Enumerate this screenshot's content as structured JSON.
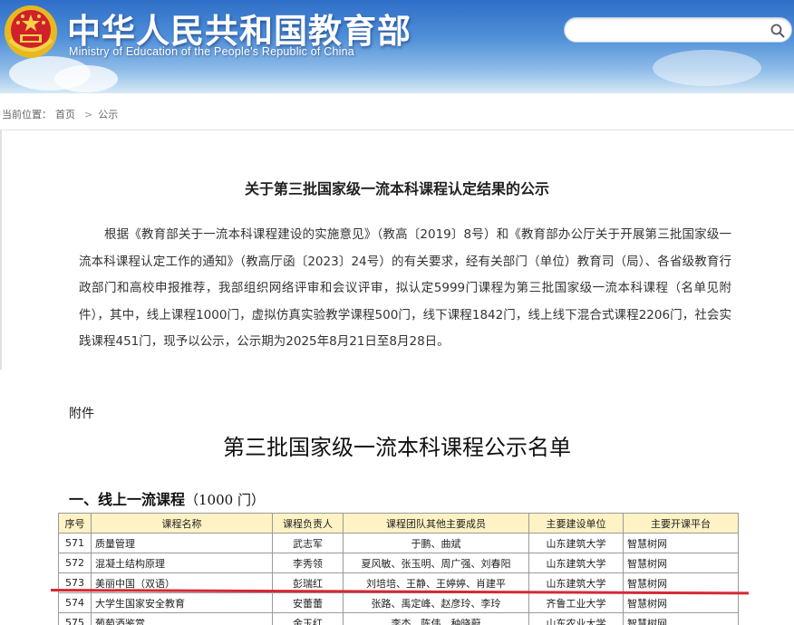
{
  "header": {
    "title": "中华人民共和国教育部",
    "subtitle": "Ministry of Education of the People's Republic of China",
    "search_placeholder": ""
  },
  "breadcrumb": {
    "label": "当前位置：",
    "items": [
      "首页",
      "公示"
    ]
  },
  "notice": {
    "title": "关于第三批国家级一流本科课程认定结果的公示",
    "body": "根据《教育部关于一流本科课程建设的实施意见》（教高〔2019〕8号）和《教育部办公厅关于开展第三批国家级一流本科课程认定工作的通知》（教高厅函〔2023〕24号）的有关要求，经有关部门（单位）教育司（局）、各省级教育行政部门和高校申报推荐，我部组织网络评审和会议评审，拟认定5999门课程为第三批国家级一流本科课程（名单见附件），其中，线上课程1000门，虚拟仿真实验教学课程500门，线下课程1842门，线上线下混合式课程2206门，社会实践课程451门，现予以公示，公示期为2025年8月21日至8月28日。"
  },
  "attachment": {
    "label": "附件",
    "title": "第三批国家级一流本科课程公示名单",
    "section": "一、线上一流课程",
    "section_count": "（1000 门）"
  },
  "table": {
    "headers": [
      "序号",
      "课程名称",
      "课程负责人",
      "课程团队其他主要成员",
      "主要建设单位",
      "主要开课平台"
    ],
    "rows": [
      [
        "571",
        "质量管理",
        "武志军",
        "于鹏、曲斌",
        "山东建筑大学",
        "智慧树网"
      ],
      [
        "572",
        "混凝土结构原理",
        "李秀领",
        "夏风敏、张玉明、周广强、刘春阳",
        "山东建筑大学",
        "智慧树网"
      ],
      [
        "573",
        "美丽中国（双语）",
        "彭瑞红",
        "刘培培、王静、王婷婷、肖建平",
        "山东建筑大学",
        "智慧树网"
      ],
      [
        "574",
        "大学生国家安全教育",
        "安蕾蕾",
        "张路、禹定峰、赵彦玲、李玲",
        "齐鲁工业大学",
        "智慧树网"
      ],
      [
        "575",
        "葡萄酒鉴赏",
        "金玉红",
        "李杰、陈伟、种晓蔚",
        "山东农业大学",
        "智慧树网"
      ]
    ]
  },
  "colors": {
    "banner_top": "#2f6fc8",
    "table_header_bg": "#fff2c4",
    "highlight_line": "#d42a35"
  },
  "icons": [
    "national-emblem-icon",
    "search-icon"
  ]
}
